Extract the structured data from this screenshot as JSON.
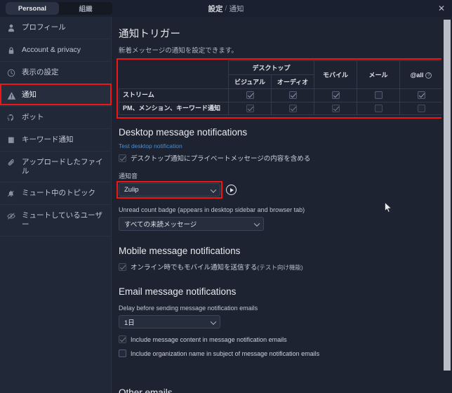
{
  "window": {
    "title_main": "設定",
    "title_sep": "/",
    "title_sub": "通知",
    "close_label": "✕"
  },
  "tabs": [
    {
      "label": "Personal",
      "active": true
    },
    {
      "label": "組織",
      "active": false
    }
  ],
  "sidebar": {
    "items": [
      {
        "label": "プロフィール",
        "icon": "user-icon"
      },
      {
        "label": "Account & privacy",
        "icon": "lock-icon"
      },
      {
        "label": "表示の設定",
        "icon": "clock-icon"
      },
      {
        "label": "通知",
        "icon": "warning-triangle-icon"
      },
      {
        "label": "ボット",
        "icon": "bot-icon"
      },
      {
        "label": "キーワード通知",
        "icon": "book-icon"
      },
      {
        "label": "アップロードしたファイル",
        "icon": "paperclip-icon"
      },
      {
        "label": "ミュート中のトピック",
        "icon": "muted-bell-icon"
      },
      {
        "label": "ミュートしているユーザー",
        "icon": "eye-slash-icon"
      }
    ],
    "selected_index": 3
  },
  "main": {
    "heading": "通知トリガー",
    "subheading": "新着メッセージの通知を設定できます。",
    "table": {
      "group_header": "デスクトップ",
      "columns": [
        "ビジュアル",
        "オーディオ",
        "モバイル",
        "メール",
        "@all"
      ],
      "at_all_hint": "?",
      "rows": [
        {
          "label": "ストリーム",
          "checks": [
            true,
            true,
            true,
            false,
            true
          ]
        },
        {
          "label": "PM、メンション、キーワード通知",
          "checks": [
            true,
            true,
            true,
            false,
            false
          ]
        }
      ]
    },
    "desktop": {
      "heading": "Desktop message notifications",
      "test_link": "Test desktop notification",
      "include_pm_content": {
        "label": "デスクトップ通知にプライベートメッセージの内容を含める",
        "checked": true
      },
      "sound_label": "通知音",
      "sound_value": "Zulip",
      "play_icon": "play-icon",
      "badge_label": "Unread count badge (appears in desktop sidebar and browser tab)",
      "badge_value": "すべての未読メッセージ"
    },
    "mobile": {
      "heading": "Mobile message notifications",
      "online_push": {
        "label": "オンライン時でもモバイル通知を送信する",
        "note": "(テスト向け機能)",
        "checked": true
      }
    },
    "email": {
      "heading": "Email message notifications",
      "delay_label": "Delay before sending message notification emails",
      "delay_value": "1日",
      "include_content": {
        "label": "Include message content in message notification emails",
        "checked": true
      },
      "include_org": {
        "label": "Include organization name in subject of message notification emails",
        "checked": false
      }
    },
    "next_section_peek": "Other emails"
  },
  "colors": {
    "highlight": "#f01616",
    "link": "#4c8fd1",
    "panel_bg": "#1d2330",
    "sidebar_bg": "#212838"
  }
}
